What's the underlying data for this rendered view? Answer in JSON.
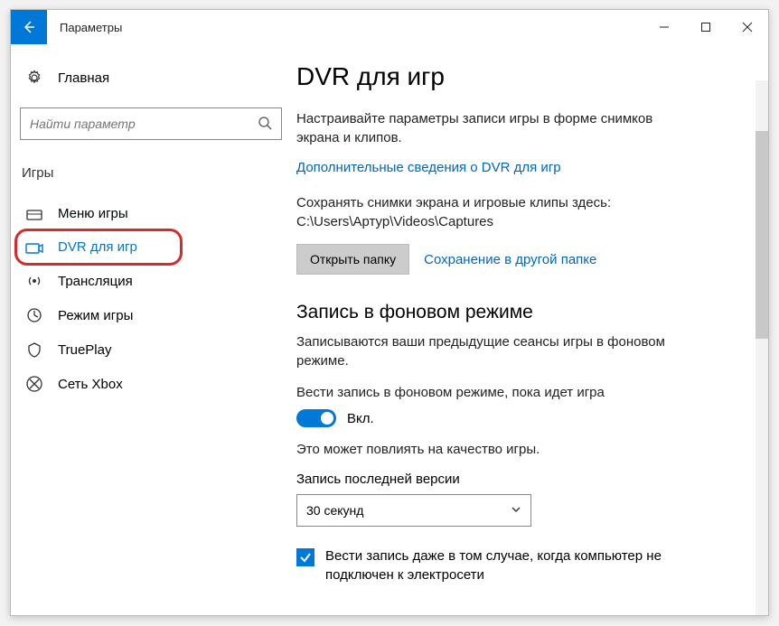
{
  "window": {
    "title": "Параметры"
  },
  "sidebar": {
    "home_label": "Главная",
    "search_placeholder": "Найти параметр",
    "group_title": "Игры",
    "items": [
      {
        "label": "Меню игры"
      },
      {
        "label": "DVR для игр"
      },
      {
        "label": "Трансляция"
      },
      {
        "label": "Режим игры"
      },
      {
        "label": "TruePlay"
      },
      {
        "label": "Сеть Xbox"
      }
    ]
  },
  "content": {
    "title": "DVR для игр",
    "intro": "Настраивайте параметры записи игры в форме снимков экрана и клипов.",
    "more_link": "Дополнительные сведения о DVR для игр",
    "save_location": "Сохранять снимки экрана и игровые клипы здесь: C:\\Users\\Артур\\Videos\\Captures",
    "open_folder_btn": "Открыть папку",
    "save_other_link": "Сохранение в другой папке",
    "bg_title": "Запись в фоновом режиме",
    "bg_desc": "Записываются ваши предыдущие сеансы игры в фоновом режиме.",
    "bg_toggle_label": "Вести запись в фоновом режиме, пока идет игра",
    "toggle_on_label": "Вкл.",
    "quality_note": "Это может повлиять на качество игры.",
    "last_record_label": "Запись последней версии",
    "last_record_value": "30 секунд",
    "checkbox_label": "Вести запись даже в том случае, когда компьютер не подключен к электросети"
  }
}
